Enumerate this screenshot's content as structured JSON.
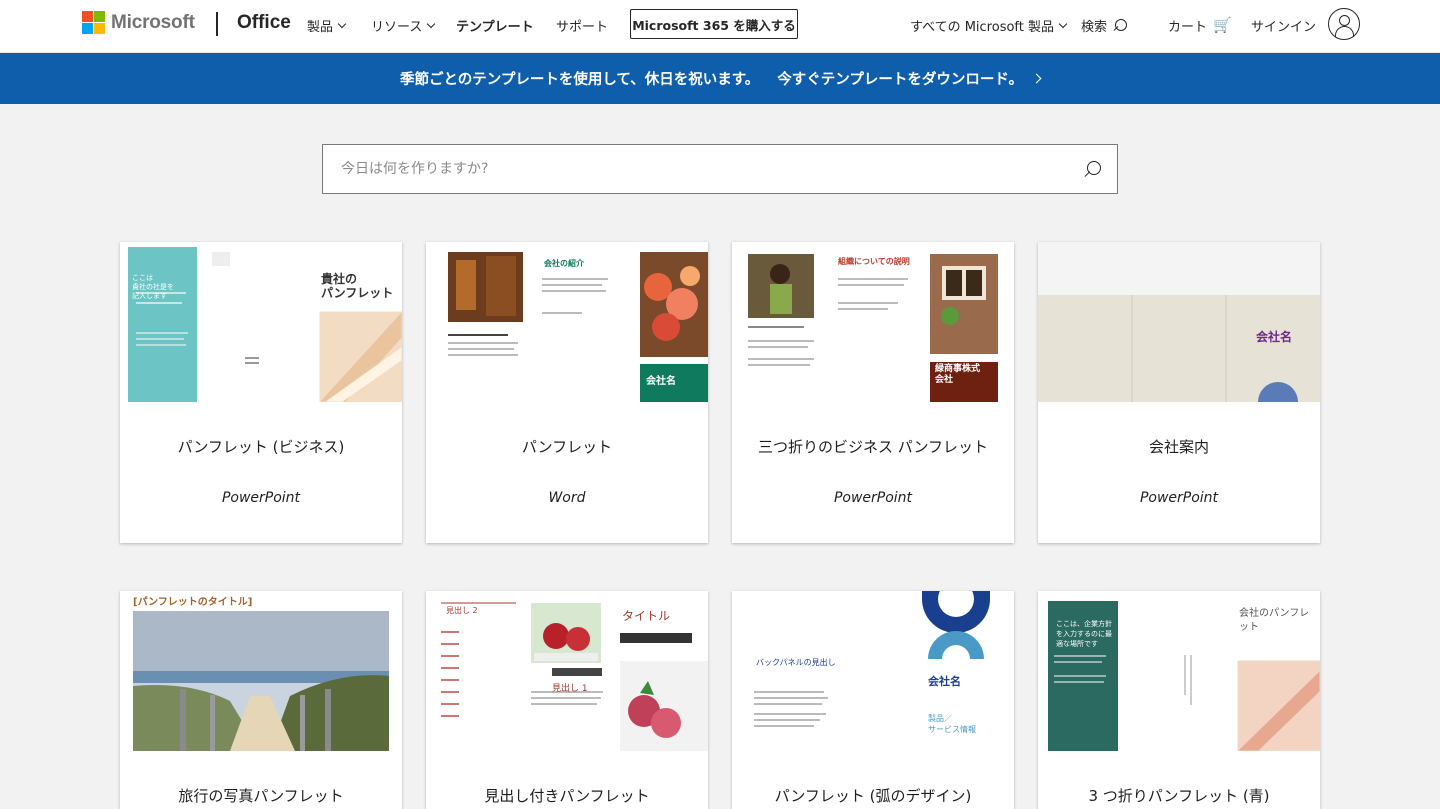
{
  "header": {
    "brand": "Microsoft",
    "product": "Office",
    "nav": [
      {
        "label": "製品",
        "dropdown": true
      },
      {
        "label": "リソース",
        "dropdown": true
      },
      {
        "label": "テンプレート",
        "dropdown": false
      },
      {
        "label": "サポート",
        "dropdown": false
      }
    ],
    "buy_button": "Microsoft 365 を購入する",
    "all_products": "すべての Microsoft 製品",
    "search_label": "検索",
    "cart_label": "カート",
    "signin_label": "サインイン"
  },
  "banner": {
    "text": "季節ごとのテンプレートを使用して、休日を祝います。",
    "link": "今すぐテンプレートをダウンロード。",
    "color": "#0f5eab"
  },
  "search": {
    "placeholder": "今日は何を作りますか?"
  },
  "templates": [
    {
      "title": "パンフレット (ビジネス)",
      "app": "PowerPoint",
      "thumb": {
        "heading": "貴社の\nパンフレット",
        "side": "ここは\n貴社の社是を\n記入します",
        "accent": "#6cc4c4"
      }
    },
    {
      "title": "パンフレット",
      "app": "Word",
      "thumb": {
        "heading": "会社の紹介",
        "block": "会社名",
        "accent": "#0f7a5e"
      }
    },
    {
      "title": "三つ折りのビジネス パンフレット",
      "app": "PowerPoint",
      "thumb": {
        "heading": "組織についての説明",
        "block": "緑商事株式\n会社",
        "accent": "#8a2a16"
      }
    },
    {
      "title": "会社案内",
      "app": "PowerPoint",
      "thumb": {
        "heading": "会社名",
        "accent": "#6a2b8c"
      }
    },
    {
      "title": "旅行の写真パンフレット",
      "app": "",
      "thumb": {
        "heading": "[パンフレットのタイトル]",
        "accent": "#a0622a"
      }
    },
    {
      "title": "見出し付きパンフレット",
      "app": "",
      "thumb": {
        "heading": "タイトル",
        "sub": "見出し 1",
        "sub2": "見出し 2",
        "accent": "#a23a2e"
      }
    },
    {
      "title": "パンフレット (弧のデザイン)",
      "app": "",
      "thumb": {
        "heading": "会社名",
        "sub": "製品／\nサービス情報",
        "side": "バックパネルの見出し",
        "accent": "#1a3f8f"
      }
    },
    {
      "title": "3 つ折りパンフレット (青)",
      "app": "",
      "thumb": {
        "heading": "会社のパンフレット",
        "side": "ここは、企業方針\nを入力するのに最\n適な場所です",
        "accent": "#2a6a60"
      }
    }
  ]
}
